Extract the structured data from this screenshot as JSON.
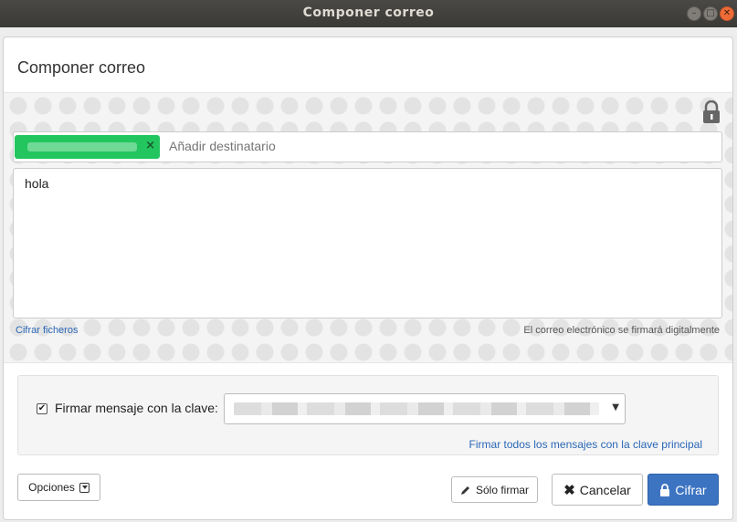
{
  "window": {
    "title": "Componer correo"
  },
  "dialog": {
    "title": "Componer correo"
  },
  "compose": {
    "recipient_placeholder": "Añadir destinatario",
    "chip_remove": "×",
    "body_text": "hola",
    "encrypt_files_link": "Cifrar ficheros",
    "signature_note": "El correo electrónico se firmará digitalmente"
  },
  "signing": {
    "checkbox_label": "Firmar mensaje con la clave:",
    "checked": true,
    "sign_all_link": "Firmar todos los mensajes con la clave principal"
  },
  "buttons": {
    "options": "Opciones",
    "sign_only": "Sólo firmar",
    "cancel": "Cancelar",
    "encrypt": "Cifrar"
  },
  "colors": {
    "accent": "#3c74c2",
    "recipient_chip": "#22c55e",
    "link": "#2a66b5"
  }
}
